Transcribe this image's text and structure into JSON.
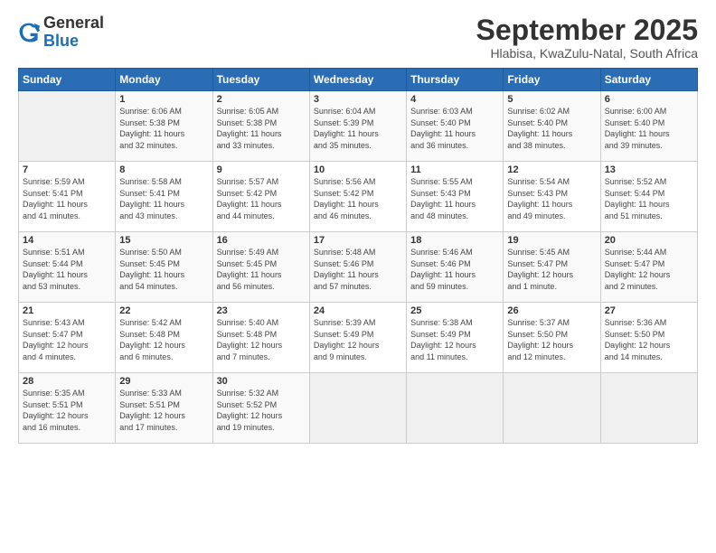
{
  "logo": {
    "general": "General",
    "blue": "Blue"
  },
  "title": "September 2025",
  "subtitle": "Hlabisa, KwaZulu-Natal, South Africa",
  "headers": [
    "Sunday",
    "Monday",
    "Tuesday",
    "Wednesday",
    "Thursday",
    "Friday",
    "Saturday"
  ],
  "weeks": [
    [
      {
        "day": "",
        "info": ""
      },
      {
        "day": "1",
        "info": "Sunrise: 6:06 AM\nSunset: 5:38 PM\nDaylight: 11 hours\nand 32 minutes."
      },
      {
        "day": "2",
        "info": "Sunrise: 6:05 AM\nSunset: 5:38 PM\nDaylight: 11 hours\nand 33 minutes."
      },
      {
        "day": "3",
        "info": "Sunrise: 6:04 AM\nSunset: 5:39 PM\nDaylight: 11 hours\nand 35 minutes."
      },
      {
        "day": "4",
        "info": "Sunrise: 6:03 AM\nSunset: 5:40 PM\nDaylight: 11 hours\nand 36 minutes."
      },
      {
        "day": "5",
        "info": "Sunrise: 6:02 AM\nSunset: 5:40 PM\nDaylight: 11 hours\nand 38 minutes."
      },
      {
        "day": "6",
        "info": "Sunrise: 6:00 AM\nSunset: 5:40 PM\nDaylight: 11 hours\nand 39 minutes."
      }
    ],
    [
      {
        "day": "7",
        "info": "Sunrise: 5:59 AM\nSunset: 5:41 PM\nDaylight: 11 hours\nand 41 minutes."
      },
      {
        "day": "8",
        "info": "Sunrise: 5:58 AM\nSunset: 5:41 PM\nDaylight: 11 hours\nand 43 minutes."
      },
      {
        "day": "9",
        "info": "Sunrise: 5:57 AM\nSunset: 5:42 PM\nDaylight: 11 hours\nand 44 minutes."
      },
      {
        "day": "10",
        "info": "Sunrise: 5:56 AM\nSunset: 5:42 PM\nDaylight: 11 hours\nand 46 minutes."
      },
      {
        "day": "11",
        "info": "Sunrise: 5:55 AM\nSunset: 5:43 PM\nDaylight: 11 hours\nand 48 minutes."
      },
      {
        "day": "12",
        "info": "Sunrise: 5:54 AM\nSunset: 5:43 PM\nDaylight: 11 hours\nand 49 minutes."
      },
      {
        "day": "13",
        "info": "Sunrise: 5:52 AM\nSunset: 5:44 PM\nDaylight: 11 hours\nand 51 minutes."
      }
    ],
    [
      {
        "day": "14",
        "info": "Sunrise: 5:51 AM\nSunset: 5:44 PM\nDaylight: 11 hours\nand 53 minutes."
      },
      {
        "day": "15",
        "info": "Sunrise: 5:50 AM\nSunset: 5:45 PM\nDaylight: 11 hours\nand 54 minutes."
      },
      {
        "day": "16",
        "info": "Sunrise: 5:49 AM\nSunset: 5:45 PM\nDaylight: 11 hours\nand 56 minutes."
      },
      {
        "day": "17",
        "info": "Sunrise: 5:48 AM\nSunset: 5:46 PM\nDaylight: 11 hours\nand 57 minutes."
      },
      {
        "day": "18",
        "info": "Sunrise: 5:46 AM\nSunset: 5:46 PM\nDaylight: 11 hours\nand 59 minutes."
      },
      {
        "day": "19",
        "info": "Sunrise: 5:45 AM\nSunset: 5:47 PM\nDaylight: 12 hours\nand 1 minute."
      },
      {
        "day": "20",
        "info": "Sunrise: 5:44 AM\nSunset: 5:47 PM\nDaylight: 12 hours\nand 2 minutes."
      }
    ],
    [
      {
        "day": "21",
        "info": "Sunrise: 5:43 AM\nSunset: 5:47 PM\nDaylight: 12 hours\nand 4 minutes."
      },
      {
        "day": "22",
        "info": "Sunrise: 5:42 AM\nSunset: 5:48 PM\nDaylight: 12 hours\nand 6 minutes."
      },
      {
        "day": "23",
        "info": "Sunrise: 5:40 AM\nSunset: 5:48 PM\nDaylight: 12 hours\nand 7 minutes."
      },
      {
        "day": "24",
        "info": "Sunrise: 5:39 AM\nSunset: 5:49 PM\nDaylight: 12 hours\nand 9 minutes."
      },
      {
        "day": "25",
        "info": "Sunrise: 5:38 AM\nSunset: 5:49 PM\nDaylight: 12 hours\nand 11 minutes."
      },
      {
        "day": "26",
        "info": "Sunrise: 5:37 AM\nSunset: 5:50 PM\nDaylight: 12 hours\nand 12 minutes."
      },
      {
        "day": "27",
        "info": "Sunrise: 5:36 AM\nSunset: 5:50 PM\nDaylight: 12 hours\nand 14 minutes."
      }
    ],
    [
      {
        "day": "28",
        "info": "Sunrise: 5:35 AM\nSunset: 5:51 PM\nDaylight: 12 hours\nand 16 minutes."
      },
      {
        "day": "29",
        "info": "Sunrise: 5:33 AM\nSunset: 5:51 PM\nDaylight: 12 hours\nand 17 minutes."
      },
      {
        "day": "30",
        "info": "Sunrise: 5:32 AM\nSunset: 5:52 PM\nDaylight: 12 hours\nand 19 minutes."
      },
      {
        "day": "",
        "info": ""
      },
      {
        "day": "",
        "info": ""
      },
      {
        "day": "",
        "info": ""
      },
      {
        "day": "",
        "info": ""
      }
    ]
  ]
}
